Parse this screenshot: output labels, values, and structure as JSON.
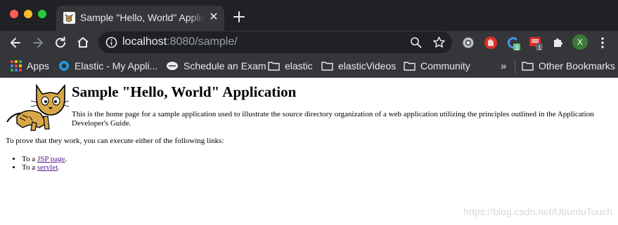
{
  "browser": {
    "tab": {
      "title": "Sample \"Hello, World\" Applicat",
      "close_glyph": "✕",
      "favicon": "tomcat-favicon-icon"
    },
    "new_tab_glyph": "+",
    "address": {
      "host": "localhost",
      "rest": ":8080/sample/"
    },
    "toolbar_icons": [
      "back-icon",
      "forward-icon",
      "reload-icon",
      "home-icon",
      "info-icon",
      "zoom-icon",
      "star-icon",
      "extension-icons",
      "avatar"
    ],
    "extensions": {
      "badge_a": "1",
      "badge_b": "1",
      "avatar_letter": "X"
    },
    "bookmarks": [
      {
        "label": "Apps",
        "icon": "apps-grid-icon"
      },
      {
        "label": "Elastic - My Appli...",
        "icon": "elastic-icon"
      },
      {
        "label": "Schedule an Exam",
        "icon": "schedule-icon"
      },
      {
        "label": "elastic",
        "icon": "folder-icon"
      },
      {
        "label": "elasticVideos",
        "icon": "folder-icon"
      },
      {
        "label": "Community",
        "icon": "folder-icon"
      }
    ],
    "overflow_glyph": "»",
    "other_bookmarks": "Other Bookmarks"
  },
  "page": {
    "title": "Sample \"Hello, World\" Application",
    "intro": "This is the home page for a sample application used to illustrate the source directory organization of a web application utilizing the principles outlined in the Application Developer's Guide.",
    "prove_text": "To prove that they work, you can execute either of the following links:",
    "links": [
      {
        "prefix": "To a ",
        "link_text": "JSP page",
        "suffix": "."
      },
      {
        "prefix": "To a ",
        "link_text": "servlet",
        "suffix": "."
      }
    ]
  },
  "watermark": "https://blog.csdn.net/UbuntuTouch",
  "colors": {
    "chrome_dark": "#202124",
    "chrome_toolbar": "#35363a",
    "link_visited": "#551a8b"
  }
}
